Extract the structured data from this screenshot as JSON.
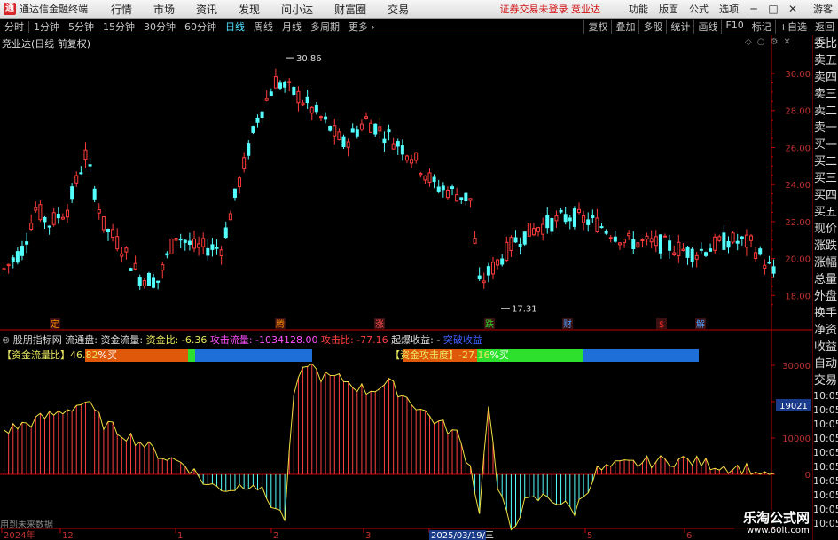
{
  "app": {
    "title": "通达信金融终端",
    "logo_text": "通"
  },
  "menu": [
    "行情",
    "市场",
    "资讯",
    "发现",
    "问小达",
    "财富圈",
    "交易"
  ],
  "status_text": "证券交易未登录  竞业达",
  "right_menu": [
    "功能",
    "版面",
    "公式",
    "选项"
  ],
  "window_buttons": [
    "─",
    "□",
    "✕"
  ],
  "guest_label": "游客",
  "periods": [
    "分时",
    "1分钟",
    "5分钟",
    "15分钟",
    "30分钟",
    "60分钟",
    "日线",
    "周线",
    "月线",
    "多周期",
    "更多"
  ],
  "active_period": "日线",
  "toolbar_right": [
    "复权",
    "叠加",
    "多股",
    "统计",
    "画线",
    "F10",
    "标记",
    "+自选",
    "返回"
  ],
  "chart_title": "竞业达(日线 前复权)",
  "right_panel": [
    "委比",
    "卖五",
    "卖四",
    "卖三",
    "卖二",
    "卖一",
    "买一",
    "买二",
    "买三",
    "买四",
    "买五",
    "现价",
    "涨跌",
    "涨幅",
    "总量",
    "外盘",
    "换手",
    "净资",
    "收益",
    "自动",
    "交易",
    "10:05",
    "10:05",
    "10:05",
    "10:05",
    "10:05",
    "10:05",
    "10:05",
    "10:05",
    "10:05",
    "10:05"
  ],
  "price_axis": [
    "30.00",
    "28.00",
    "26.00",
    "24.00",
    "22.00",
    "20.00",
    "18.00"
  ],
  "indicator_axis": [
    "30000",
    "20000",
    "10000",
    "0"
  ],
  "current_value_tag": "19021",
  "high_label": "30.86",
  "low_label": "17.31",
  "event_markers": [
    {
      "label": "定",
      "color": "#ff8c00"
    },
    {
      "label": "腾",
      "color": "#ff8c00"
    },
    {
      "label": "涨",
      "color": "#ff5050"
    },
    {
      "label": "跌",
      "color": "#2fd02f"
    },
    {
      "label": "财",
      "color": "#4aa0ff"
    },
    {
      "label": "$",
      "color": "#ff3030"
    },
    {
      "label": "解",
      "color": "#4aa0ff"
    }
  ],
  "indicator": {
    "name": "股朋指标网",
    "field1": "流通盘:",
    "field2": "资金流量:",
    "field3_label": "资金比:",
    "field3_value": "-6.36",
    "field4": "攻击流量: -1034128.00",
    "field5": "攻击比: -77.16",
    "field6": "起爆收益: -",
    "field7": "突破收益"
  },
  "bar1": {
    "label": "【资金流量比】",
    "value": "46.82",
    "unit": "%买"
  },
  "bar2": {
    "label": "【资金攻击度】",
    "value": "-27.16",
    "unit": "%买"
  },
  "bottom_note": "用到未来数据",
  "dates": [
    "2024年",
    "12",
    "1",
    "2",
    "3",
    "2025/03/19/三",
    "5",
    "6"
  ],
  "watermark": {
    "line1": "乐淘公式网",
    "line2": "www.60lt.com"
  },
  "colors": {
    "up": "#ff3c3c",
    "down": "#54ffff",
    "axis": "#c00000",
    "grid": "#3a0000"
  }
}
